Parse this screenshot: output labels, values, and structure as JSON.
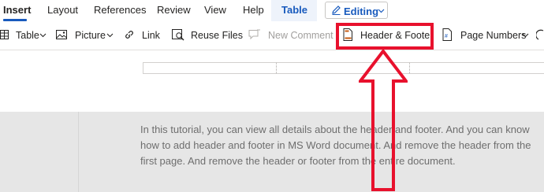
{
  "tabs": {
    "insert": "Insert",
    "layout": "Layout",
    "references": "References",
    "review": "Review",
    "view": "View",
    "help": "Help",
    "table": "Table"
  },
  "editing": {
    "label": "Editing",
    "icon": "pencil-icon"
  },
  "ribbon": {
    "table": "Table",
    "picture": "Picture",
    "link": "Link",
    "reuse_files": "Reuse Files",
    "new_comment": "New Comment",
    "header_footer": "Header & Footer",
    "page_numbers": "Page Numbers"
  },
  "document": {
    "paragraph": "In this tutorial, you can view all details about the header and footer. And you can know how to add header and footer in MS Word document. And remove the header from the first page. And remove the header or footer from the entire document."
  },
  "colors": {
    "accent": "#185abd",
    "highlight": "#e8112d",
    "page_gray": "#e6e6e6"
  }
}
